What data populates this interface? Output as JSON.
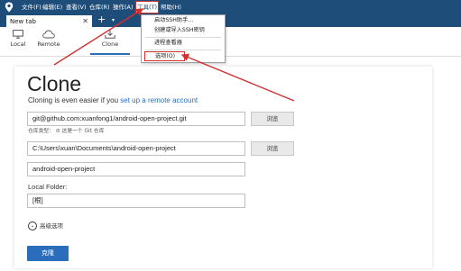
{
  "menu": {
    "items": [
      "文件(F)",
      "编辑(E)",
      "查看(V)",
      "仓库(R)",
      "操作(A)",
      "工具(T)",
      "帮助(H)"
    ],
    "active_index": 5
  },
  "tabs": {
    "current": "New tab",
    "close": "✕",
    "new_tab": "+",
    "dropdown": "▾"
  },
  "toolbar": {
    "local": "Local",
    "remote": "Remote",
    "clone": "Clone"
  },
  "tools_menu": {
    "items": [
      "启动SSH助手...",
      "创建或导入SSH密钥",
      "进程查看器",
      "选项(O)"
    ],
    "highlighted_index": 3
  },
  "clone": {
    "title": "Clone",
    "subtitle_prefix": "Cloning is even easier if you ",
    "subtitle_link": "set up a remote account",
    "source_url": "git@github.com:xuanfong1/android-open-project.git",
    "browse_label": "浏览",
    "repo_type_hint": "仓库类型：  ⊘  这是一个 Git 仓库",
    "destination_path": "C:\\Users\\xuan\\Documents\\android-open-project",
    "browse2_label": "浏览",
    "name": "android-open-project",
    "local_folder_label": "Local Folder:",
    "local_folder_value": "[根]",
    "advanced": "高级选项",
    "advanced_icon": "⌄",
    "clone_button": "克隆"
  },
  "colors": {
    "titlebar": "#1e4d79",
    "accent": "#2a6ebb",
    "annotation_red": "#d03030"
  }
}
